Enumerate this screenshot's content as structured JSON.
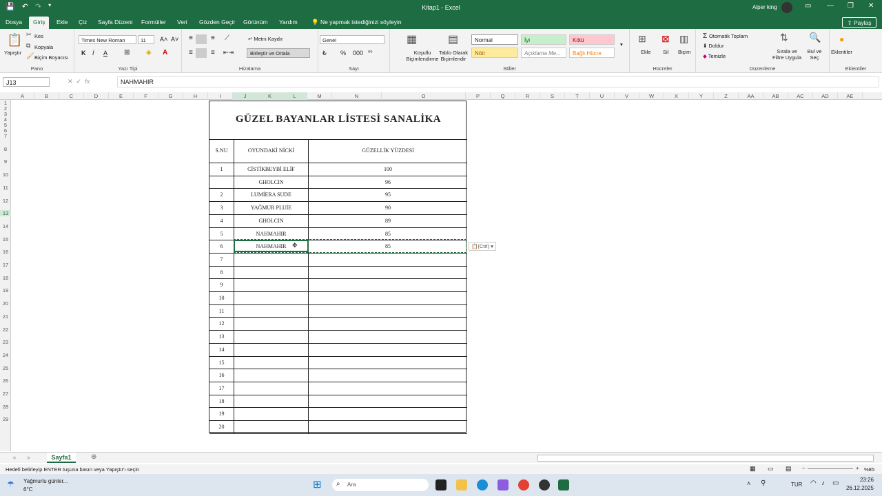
{
  "window": {
    "title": "Kitap1 - Excel",
    "user": "Alper king",
    "qat": [
      "save",
      "undo",
      "redo"
    ]
  },
  "tabs": [
    "Dosya",
    "Giriş",
    "Ekle",
    "Çiz",
    "Sayfa Düzeni",
    "Formüller",
    "Veri",
    "Gözden Geçir",
    "Görünüm",
    "Yardım"
  ],
  "active_tab": "Giriş",
  "tell_me": "Ne yapmak istediğinizi söyleyin",
  "share": "Paylaş",
  "ribbon": {
    "clipboard": {
      "paste": "Yapıştır",
      "cut": "Kes",
      "copy": "Kopyala",
      "format_painter": "Biçim Boyacısı",
      "label": "Pano"
    },
    "font": {
      "name": "Times New Roman",
      "size": "11",
      "label": "Yazı Tipi",
      "bold": "K",
      "italic": "İ",
      "underline": "A"
    },
    "alignment": {
      "wrap": "Metni Kaydır",
      "merge": "Birleştir ve Ortala",
      "label": "Hizalama"
    },
    "number": {
      "format": "Genel",
      "percent": "%",
      "label": "Sayı"
    },
    "styles": {
      "conditional": "Koşullu Biçimlendirme",
      "as_table": "Tablo Olarak Biçimlendir",
      "normal": "Normal",
      "iyi": "İyi",
      "kotu": "Kötü",
      "notr": "Nötr",
      "aciklama": "Açıklama Me...",
      "bagli": "Bağlı Hücre",
      "label": "Stiller"
    },
    "cells": {
      "insert": "Ekle",
      "delete": "Sil",
      "format": "Biçim",
      "label": "Hücreler"
    },
    "editing": {
      "autosum": "Otomatik Toplam",
      "fill": "Doldur",
      "clear": "Temizle",
      "sort": "Sırala ve Filtre Uygula",
      "find": "Bul ve Seç",
      "label": "Düzenleme"
    },
    "addins": {
      "label": "Eklentiler",
      "btn": "Eklentiler"
    }
  },
  "name_box": "J13",
  "formula": "NAHMAHIR",
  "columns": [
    "A",
    "B",
    "C",
    "D",
    "E",
    "F",
    "G",
    "H",
    "I",
    "J",
    "K",
    "L",
    "M",
    "N",
    "O",
    "P",
    "Q",
    "R",
    "S",
    "T",
    "U",
    "V",
    "W",
    "X",
    "Y",
    "Z",
    "AA",
    "AB",
    "AC",
    "AD",
    "AE"
  ],
  "rows": [
    "1",
    "2",
    "3",
    "4",
    "5",
    "6",
    "7",
    "8",
    "9",
    "10",
    "11",
    "12",
    "13",
    "14",
    "15",
    "16",
    "17",
    "18",
    "19",
    "20",
    "21",
    "22",
    "23",
    "24",
    "25",
    "26",
    "27",
    "28",
    "29"
  ],
  "sheet": {
    "title": "GÜZEL BAYANLAR LİSTESİ SANALİKA",
    "headers": [
      "S.NU",
      "OYUNDAKİ NİCKİ",
      "GÜZELLİK YÜZDESİ"
    ],
    "rows": [
      [
        "1",
        "CİSTİKBEYBİ ELİF",
        "100"
      ],
      [
        "",
        "GHOLCIN",
        "96"
      ],
      [
        "2",
        "LUMİERA SUDE",
        "95"
      ],
      [
        "3",
        "YAĞMUR PLUİE",
        "90"
      ],
      [
        "4",
        "GHOLCIN",
        "89"
      ],
      [
        "5",
        "NAHMAHIR",
        "85"
      ],
      [
        "6",
        "NAHMAHIR",
        "85"
      ],
      [
        "7",
        "",
        ""
      ],
      [
        "8",
        "",
        ""
      ],
      [
        "9",
        "",
        ""
      ],
      [
        "10",
        "",
        ""
      ],
      [
        "11",
        "",
        ""
      ],
      [
        "12",
        "",
        ""
      ],
      [
        "13",
        "",
        ""
      ],
      [
        "14",
        "",
        ""
      ],
      [
        "15",
        "",
        ""
      ],
      [
        "16",
        "",
        ""
      ],
      [
        "17",
        "",
        ""
      ],
      [
        "18",
        "",
        ""
      ],
      [
        "19",
        "",
        ""
      ],
      [
        "20",
        "",
        ""
      ]
    ]
  },
  "paste_options": "(Ctrl)",
  "sheet_tab": "Sayfa1",
  "status": "Hedefi belirleyip ENTER tuşuna basın veya Yapıştır'ı seçin",
  "zoom": "%85",
  "taskbar": {
    "weather": "Yağmurlu günler...",
    "temp": "6°C",
    "search": "Ara",
    "lang": "TUR",
    "time": "23:26",
    "date": "26.12.2025"
  }
}
